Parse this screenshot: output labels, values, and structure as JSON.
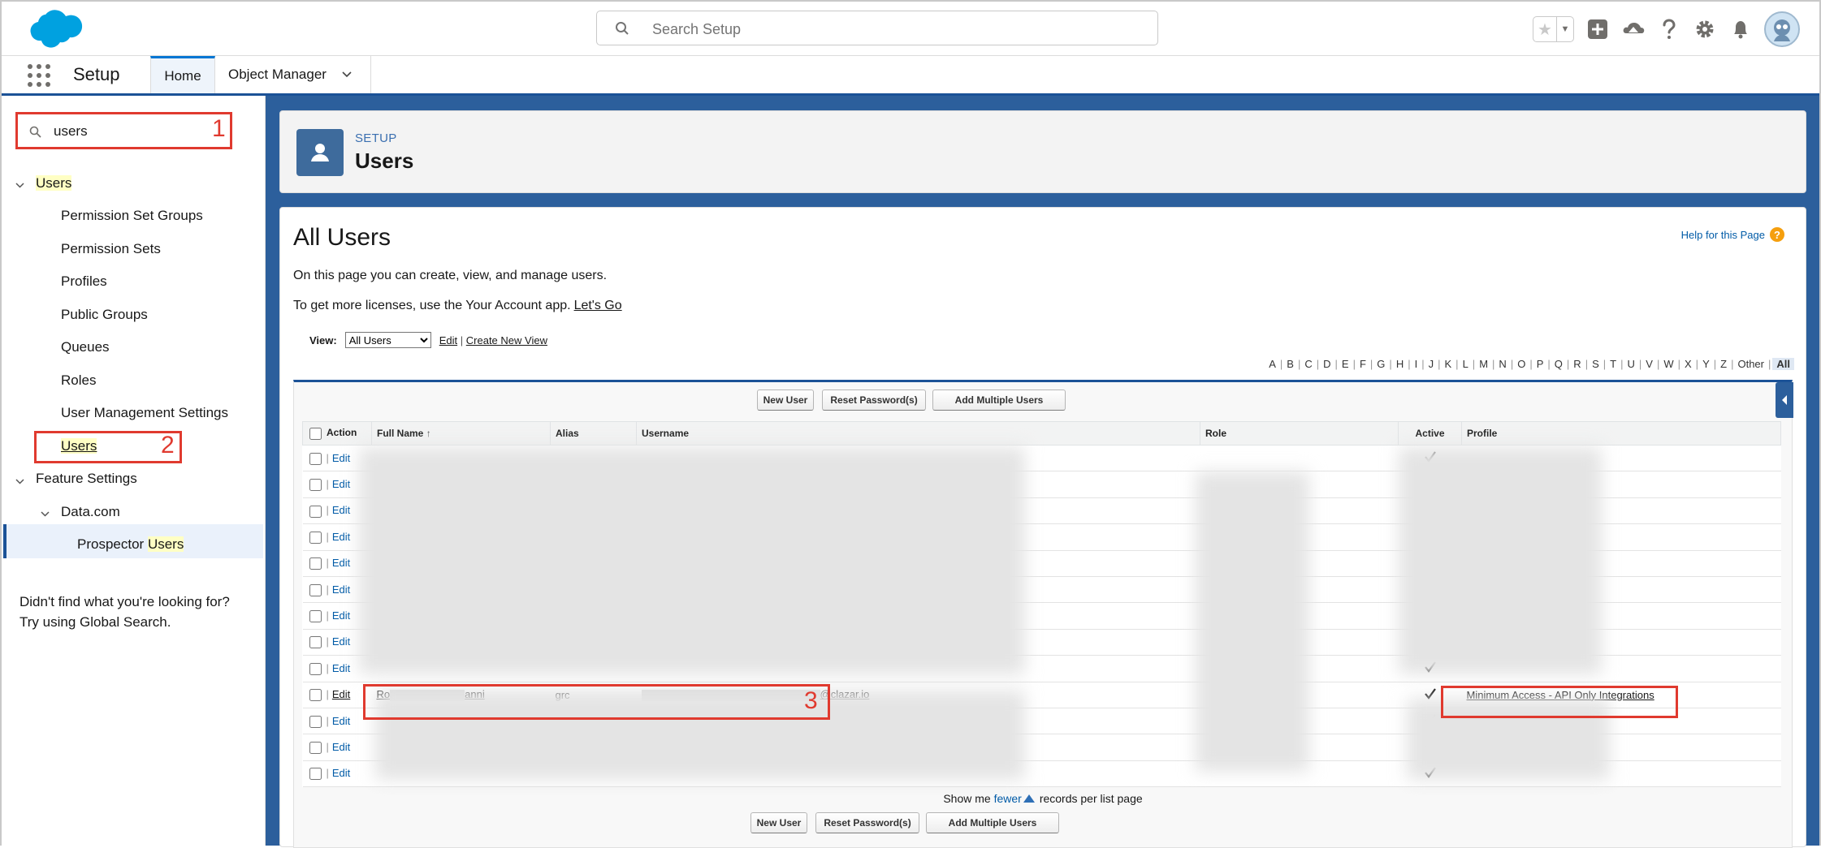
{
  "header": {
    "search_placeholder": "Search Setup",
    "icons": [
      "salesforce-cloud-logo",
      "favorites-star-icon",
      "favorites-list-icon",
      "global-actions-icon",
      "trailhead-icon",
      "help-icon",
      "gear-icon",
      "notifications-bell-icon",
      "user-avatar"
    ]
  },
  "nav": {
    "app_name": "Setup",
    "tabs": [
      {
        "label": "Home",
        "active": true
      },
      {
        "label": "Object Manager",
        "active": false
      }
    ]
  },
  "sidebar": {
    "quick_find_value": "users",
    "tree": {
      "users_label": "Users",
      "children": [
        "Permission Set Groups",
        "Permission Sets",
        "Profiles",
        "Public Groups",
        "Queues",
        "Roles",
        "User Management Settings",
        "Users"
      ],
      "feature_settings_label": "Feature Settings",
      "datacom_label": "Data.com",
      "prospector_prefix": "Prospector ",
      "prospector_highlight": "Users"
    },
    "not_found_line1": "Didn't find what you're looking for?",
    "not_found_line2": "Try using Global Search."
  },
  "annotations": [
    "1",
    "2",
    "3"
  ],
  "page_header": {
    "kicker": "SETUP",
    "title": "Users"
  },
  "main": {
    "title": "All Users",
    "help_link": "Help for this Page",
    "description": "On this page you can create, view, and manage users.",
    "licenses_text": "To get more licenses, use the Your Account app.",
    "lets_go": "Let's Go",
    "view_label": "View:",
    "view_selected": "All Users",
    "edit_view": "Edit",
    "create_new_view": "Create New View",
    "alphabet": [
      "A",
      "B",
      "C",
      "D",
      "E",
      "F",
      "G",
      "H",
      "I",
      "J",
      "K",
      "L",
      "M",
      "N",
      "O",
      "P",
      "Q",
      "R",
      "S",
      "T",
      "U",
      "V",
      "W",
      "X",
      "Y",
      "Z",
      "Other",
      "All"
    ],
    "alphabet_active": "All",
    "buttons": {
      "new_user": "New User",
      "reset_passwords": "Reset Password(s)",
      "add_multiple_users": "Add Multiple Users"
    },
    "table": {
      "columns": [
        "Action",
        "Full Name",
        "Alias",
        "Username",
        "Role",
        "Active",
        "Profile"
      ],
      "sort_indicator": "↑",
      "edit_label": "Edit",
      "row_count": 13,
      "highlighted_row": {
        "index": 9,
        "full_name_start": "Ro",
        "full_name_end": "anni",
        "alias": "grc",
        "username_end": "@clazar.io",
        "profile": "Minimum Access - API Only Integrations"
      }
    },
    "show_me": "Show me",
    "fewer": "fewer",
    "records_per_page": "records per list page"
  }
}
